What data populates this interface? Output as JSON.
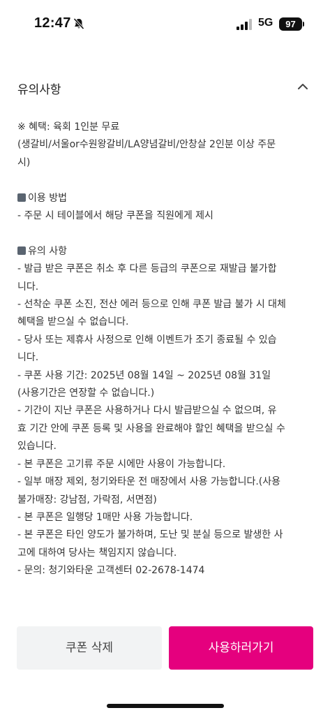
{
  "status_bar": {
    "time": "12:47",
    "network": "5G",
    "battery": "97"
  },
  "section": {
    "title": "유의사항"
  },
  "notes": {
    "lines": [
      {
        "text": "※ 혜택: 육회 1인분 무료"
      },
      {
        "text": "(생갈비/서울or수원왕갈비/LA양념갈비/안창살 2인분 이상 주문"
      },
      {
        "text": "시)"
      },
      {
        "text": ""
      },
      {
        "text": "이용 방법",
        "bullet": true
      },
      {
        "text": "- 주문 시 테이블에서 해당 쿠폰을 직원에게 제시"
      },
      {
        "text": ""
      },
      {
        "text": "유의 사항",
        "bullet": true
      },
      {
        "text": "- 발급 받은 쿠폰은 취소 후 다른 등급의 쿠폰으로 재발급 불가합"
      },
      {
        "text": "니다."
      },
      {
        "text": "- 선착순 쿠폰 소진, 전산 에러 등으로 인해 쿠폰 발급 불가 시 대체"
      },
      {
        "text": "혜택을 받으실 수 없습니다."
      },
      {
        "text": "- 당사 또는 제휴사 사정으로 인해 이벤트가 조기 종료될 수 있습"
      },
      {
        "text": "니다."
      },
      {
        "text": "- 쿠폰 사용 기간: 2025년 08월 14일 ~ 2025년 08월 31일"
      },
      {
        "text": "(사용기간은 연장할 수 없습니다.)"
      },
      {
        "text": "- 기간이 지난 쿠폰은 사용하거나 다시 발급받으실 수 없으며, 유"
      },
      {
        "text": "효 기간 안에 쿠폰 등록 및 사용을 완료해야 할인 혜택을 받으실 수"
      },
      {
        "text": "있습니다."
      },
      {
        "text": "- 본 쿠폰은 고기류 주문 시에만 사용이 가능합니다."
      },
      {
        "text": "- 일부 매장 제외, 청기와타운 전 매장에서 사용 가능합니다.(사용"
      },
      {
        "text": "불가매장: 강남점, 가락점, 서면점)"
      },
      {
        "text": "- 본 쿠폰은 일행당 1매만 사용 가능합니다."
      },
      {
        "text": "- 본 쿠폰은 타인 양도가 불가하며, 도난 및 분실 등으로 발생한 사"
      },
      {
        "text": "고에 대하여 당사는 책임지지 않습니다."
      },
      {
        "text": "- 문의: 청기와타운 고객센터 02-2678-1474"
      }
    ]
  },
  "buttons": {
    "delete_label": "쿠폰 삭제",
    "use_label": "사용하러가기"
  },
  "colors": {
    "accent": "#e5007e",
    "secondary_button_bg": "#f2f3f4",
    "bullet": "#5a6470"
  },
  "icons": {
    "silent": "bell-slash-icon",
    "signal": "cellular-signal-icon",
    "collapse": "chevron-up-icon"
  }
}
